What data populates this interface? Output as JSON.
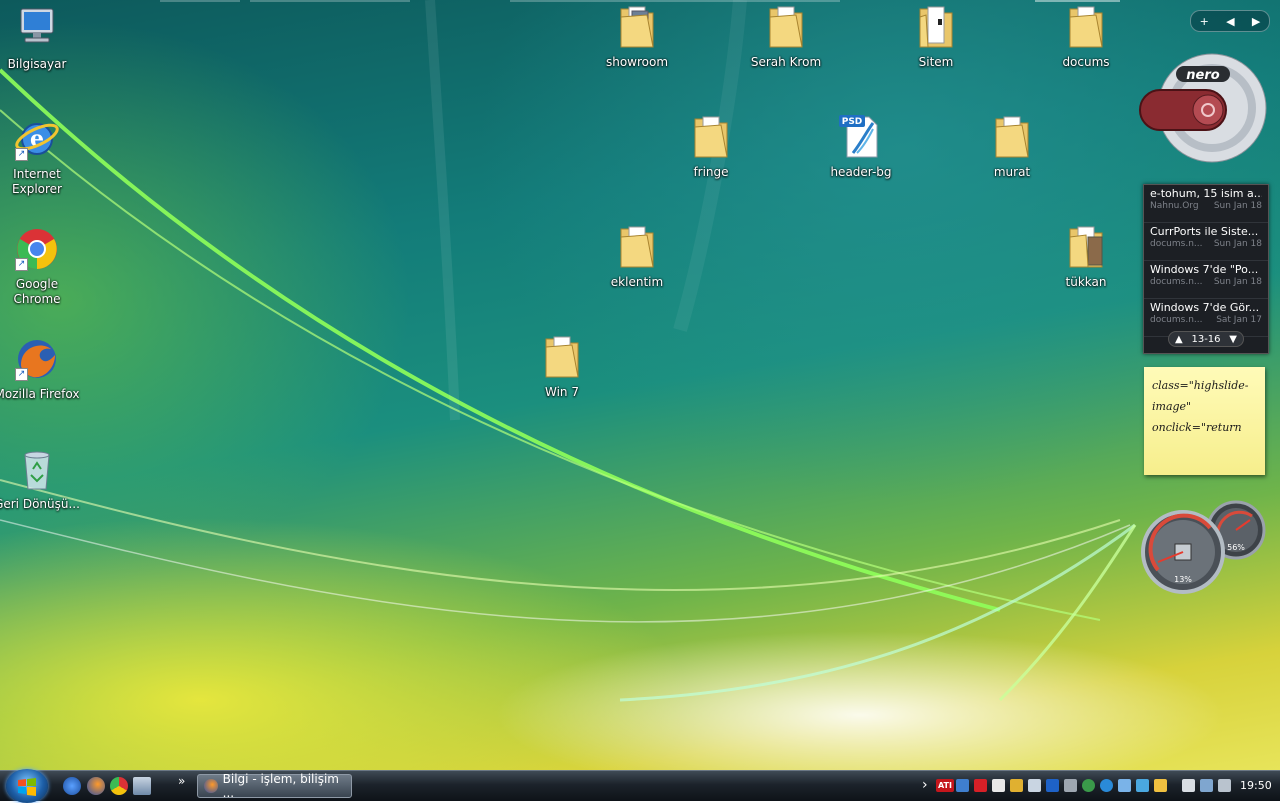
{
  "desktop": {
    "icons": {
      "computer": "Bilgisayar",
      "ie": "Internet Explorer",
      "chrome": "Google Chrome",
      "firefox": "Mozilla Firefox",
      "recycle": "Geri Dönüşü...",
      "showroom": "showroom",
      "serah_krom": "Serah Krom",
      "sitem": "Sitem",
      "docums": "docums",
      "fringe": "fringe",
      "header_bg": "header-bg",
      "murat": "murat",
      "eklentim": "eklentim",
      "tukkan": "tükkan",
      "win7": "Win 7"
    },
    "psd_badge": "PSD"
  },
  "sidebar": {
    "controls": {
      "add": "+",
      "prev": "◀",
      "next": "▶"
    },
    "nero_logo": "nero",
    "feed": {
      "items": [
        {
          "title": "e-tohum, 15 isim a...",
          "source": "Nahnu.Org",
          "date": "Sun Jan 18"
        },
        {
          "title": "CurrPorts ile Siste...",
          "source": "docums.n...",
          "date": "Sun Jan 18"
        },
        {
          "title": "Windows 7'de \"Po...",
          "source": "docums.n...",
          "date": "Sun Jan 18"
        },
        {
          "title": "Windows 7'de Gör...",
          "source": "docums.n...",
          "date": "Sat Jan 17"
        }
      ],
      "page": "13-16",
      "up": "▲",
      "down": "▼"
    },
    "note": {
      "text": "class=\"highslide-image\" onclick=\"return"
    },
    "cpu_meter": {
      "cpu_percent": "13%",
      "memory_percent": "56%"
    }
  },
  "taskbar": {
    "quicklaunch_expand": "»",
    "window_title": "Bilgi - işlem, bilişim ...",
    "tray_expand": "›",
    "tray_ati": "ATI",
    "clock": "19:50"
  },
  "colors": {
    "note_yellow": "#fffbb8",
    "feed_background": "#1c1f24",
    "taskbar": "#1c232b"
  }
}
